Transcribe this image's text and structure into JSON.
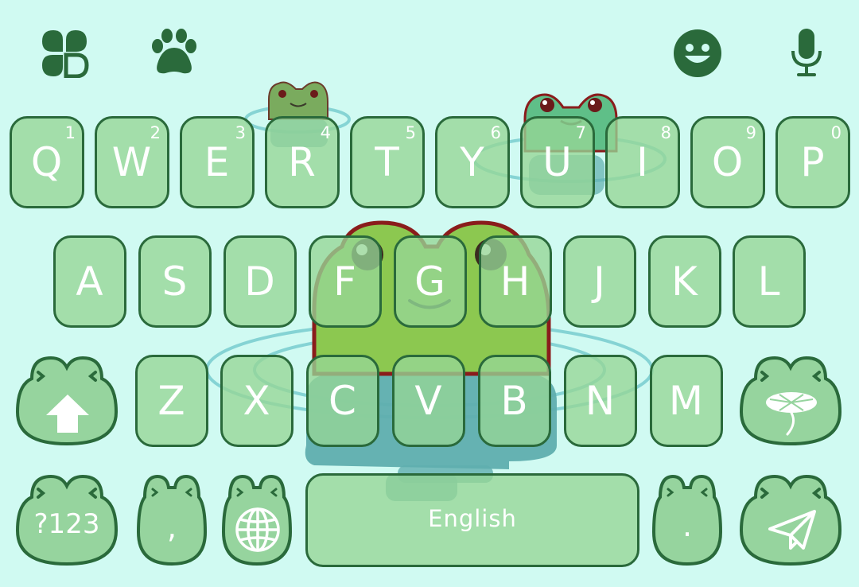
{
  "toolbar": {
    "left_icons": [
      "clover-icon",
      "paw-icon"
    ],
    "right_icons": [
      "emoji-icon",
      "microphone-icon"
    ]
  },
  "rows": {
    "row1": [
      {
        "label": "Q",
        "hint": "1"
      },
      {
        "label": "W",
        "hint": "2"
      },
      {
        "label": "E",
        "hint": "3"
      },
      {
        "label": "R",
        "hint": "4"
      },
      {
        "label": "T",
        "hint": "5"
      },
      {
        "label": "Y",
        "hint": "6"
      },
      {
        "label": "U",
        "hint": "7"
      },
      {
        "label": "I",
        "hint": "8"
      },
      {
        "label": "O",
        "hint": "9"
      },
      {
        "label": "P",
        "hint": "0"
      }
    ],
    "row2": [
      {
        "label": "A"
      },
      {
        "label": "S"
      },
      {
        "label": "D"
      },
      {
        "label": "F"
      },
      {
        "label": "G"
      },
      {
        "label": "H"
      },
      {
        "label": "J"
      },
      {
        "label": "K"
      },
      {
        "label": "L"
      }
    ],
    "row3": [
      {
        "label": "Z"
      },
      {
        "label": "X"
      },
      {
        "label": "C"
      },
      {
        "label": "V"
      },
      {
        "label": "B"
      },
      {
        "label": "N"
      },
      {
        "label": "M"
      }
    ]
  },
  "special": {
    "shift_icon": "shift-arrow-icon",
    "symbols_label": "?123",
    "comma_label": ",",
    "globe_icon": "globe-icon",
    "space_label": "English",
    "period_label": ".",
    "send_icon": "paper-plane-icon",
    "lilypad_icon": "lily-pad-icon"
  },
  "colors": {
    "background": "#d0faf2",
    "key_fill": "#9fd9a4",
    "key_border": "#2a6a3b",
    "icon": "#2a6a3b",
    "frog_green": "#8cc850"
  }
}
